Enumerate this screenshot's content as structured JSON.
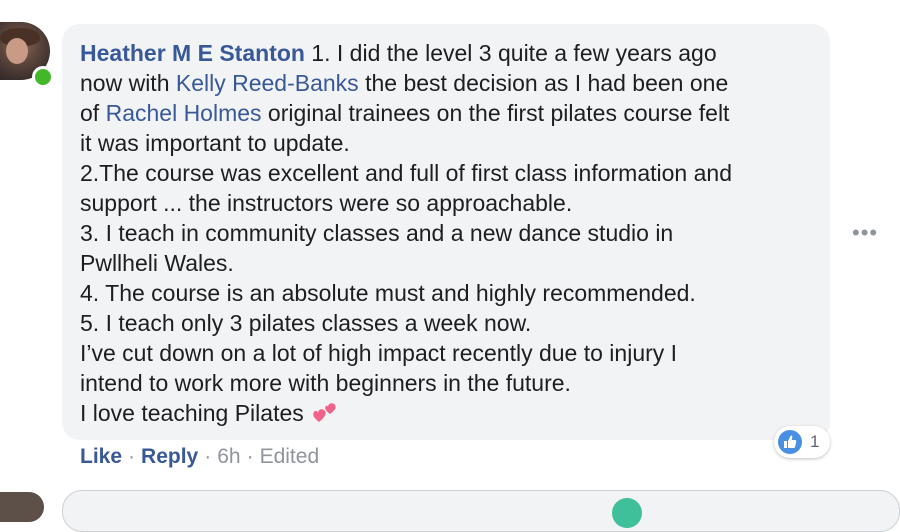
{
  "comment": {
    "author": "Heather M E Stanton",
    "segments": {
      "p1_a": " 1. I did the level 3 quite a few years ago",
      "p1_b": "now with ",
      "mention1": "Kelly Reed-Banks",
      "p1_c": " the best decision as I had been one",
      "p1_d": "of ",
      "mention2": "Rachel Holmes",
      "p1_e": " original trainees on the first pilates course felt",
      "p1_f": "it was important to update.",
      "l2a": "2.The course was excellent and full of first class information and",
      "l2b": "support ... the instructors were so approachable.",
      "l3a": "3. I teach in community classes and a new dance studio in",
      "l3b": "Pwllheli Wales.",
      "l4": "4. The course is an absolute must and highly recommended.",
      "l5": "5. I teach only 3 pilates classes a week now.",
      "l6a": "I’ve cut down on a lot of high impact recently due to injury I",
      "l6b": "intend to work more with beginners in the future.",
      "l7": "I love teaching Pilates "
    },
    "emoji": "two-hearts",
    "reactions": {
      "type": "like",
      "count": "1"
    },
    "actions": {
      "like": "Like",
      "dot": "·",
      "reply": "Reply",
      "time": "6h",
      "edited": "Edited"
    },
    "more_glyph": "•••"
  },
  "colors": {
    "link": "#385898",
    "text": "#1c1e21",
    "bubble": "#f2f3f5",
    "meta": "#90949c",
    "online": "#42b72a",
    "like": "#4a90e2"
  }
}
